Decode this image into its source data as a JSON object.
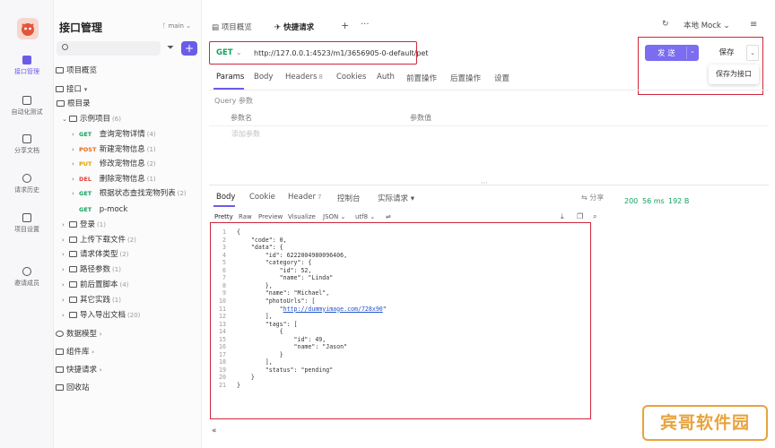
{
  "rail": {
    "items": [
      {
        "label": "接口管理",
        "icon": "api-icon"
      },
      {
        "label": "自动化测试",
        "icon": "automation-icon"
      },
      {
        "label": "分享文档",
        "icon": "share-doc-icon"
      },
      {
        "label": "请求历史",
        "icon": "history-icon"
      },
      {
        "label": "项目设置",
        "icon": "settings-icon"
      },
      {
        "label": "邀请成员",
        "icon": "invite-icon"
      }
    ]
  },
  "tree": {
    "title": "接口管理",
    "branch": "main",
    "overview": "项目概览",
    "interfaces": "接口",
    "root": "根目录",
    "sample_folder": {
      "label": "示例项目",
      "count": "(6)"
    },
    "endpoints": [
      {
        "method": "GET",
        "label": "查询宠物详情",
        "count": "(4)"
      },
      {
        "method": "POST",
        "label": "新建宠物信息",
        "count": "(1)"
      },
      {
        "method": "PUT",
        "label": "修改宠物信息",
        "count": "(2)"
      },
      {
        "method": "DEL",
        "label": "删除宠物信息",
        "count": "(1)"
      },
      {
        "method": "GET",
        "label": "根据状态查找宠物列表",
        "count": "(2)"
      },
      {
        "method": "GET",
        "label": "p-mock",
        "count": ""
      }
    ],
    "folders": [
      {
        "label": "登录",
        "count": "(1)"
      },
      {
        "label": "上传下载文件",
        "count": "(2)"
      },
      {
        "label": "请求体类型",
        "count": "(2)"
      },
      {
        "label": "路径参数",
        "count": "(1)"
      },
      {
        "label": "前后置脚本",
        "count": "(4)"
      },
      {
        "label": "其它实践",
        "count": "(1)"
      },
      {
        "label": "导入导出文档",
        "count": "(20)"
      }
    ],
    "sections": [
      {
        "label": "数据模型"
      },
      {
        "label": "组件库"
      },
      {
        "label": "快捷请求"
      },
      {
        "label": "回收站"
      }
    ]
  },
  "top": {
    "tab_overview": "项目概览",
    "tab_quick": "快捷请求",
    "env": "本地 Mock"
  },
  "request": {
    "method": "GET",
    "url": "http://127.0.0.1:4523/m1/3656905-0-default/pet",
    "send": "发 送",
    "save": "保存",
    "save_as": "保存为接口",
    "tabs": [
      {
        "label": "Params",
        "badge": ""
      },
      {
        "label": "Body",
        "badge": ""
      },
      {
        "label": "Headers",
        "badge": "8"
      },
      {
        "label": "Cookies",
        "badge": ""
      },
      {
        "label": "Auth",
        "badge": ""
      },
      {
        "label": "前置操作",
        "badge": ""
      },
      {
        "label": "后置操作",
        "badge": ""
      },
      {
        "label": "设置",
        "badge": ""
      }
    ],
    "query_label": "Query 参数",
    "col_name": "参数名",
    "col_value": "参数值",
    "add_param_placeholder": "添加参数"
  },
  "response": {
    "tabs": [
      {
        "label": "Body",
        "badge": ""
      },
      {
        "label": "Cookie",
        "badge": ""
      },
      {
        "label": "Header",
        "badge": "7"
      },
      {
        "label": "控制台",
        "badge": ""
      },
      {
        "label": "实际请求",
        "badge": ""
      }
    ],
    "share": "分享",
    "status": "200",
    "time": "56 ms",
    "size": "192 B",
    "formats": [
      "Pretty",
      "Raw",
      "Preview",
      "Visualize",
      "JSON",
      "utf8"
    ],
    "code_lines": [
      "{",
      "    \"code\": 0,",
      "    \"data\": {",
      "        \"id\": 6222004980096406,",
      "        \"category\": {",
      "            \"id\": 52,",
      "            \"name\": \"Linda\"",
      "        },",
      "        \"name\": \"Michael\",",
      "        \"photoUrls\": [",
      "            \"http://dummyimage.com/728x90\"",
      "        ],",
      "        \"tags\": [",
      "            {",
      "                \"id\": 49,",
      "                \"name\": \"Jason\"",
      "            }",
      "        ],",
      "        \"status\": \"pending\"",
      "    }",
      "}"
    ]
  },
  "watermark": {
    "text": "宾哥软件园"
  },
  "colors": {
    "accent": "#6b5ce7",
    "get": "#13a35c",
    "highlight": "#d0263c"
  }
}
